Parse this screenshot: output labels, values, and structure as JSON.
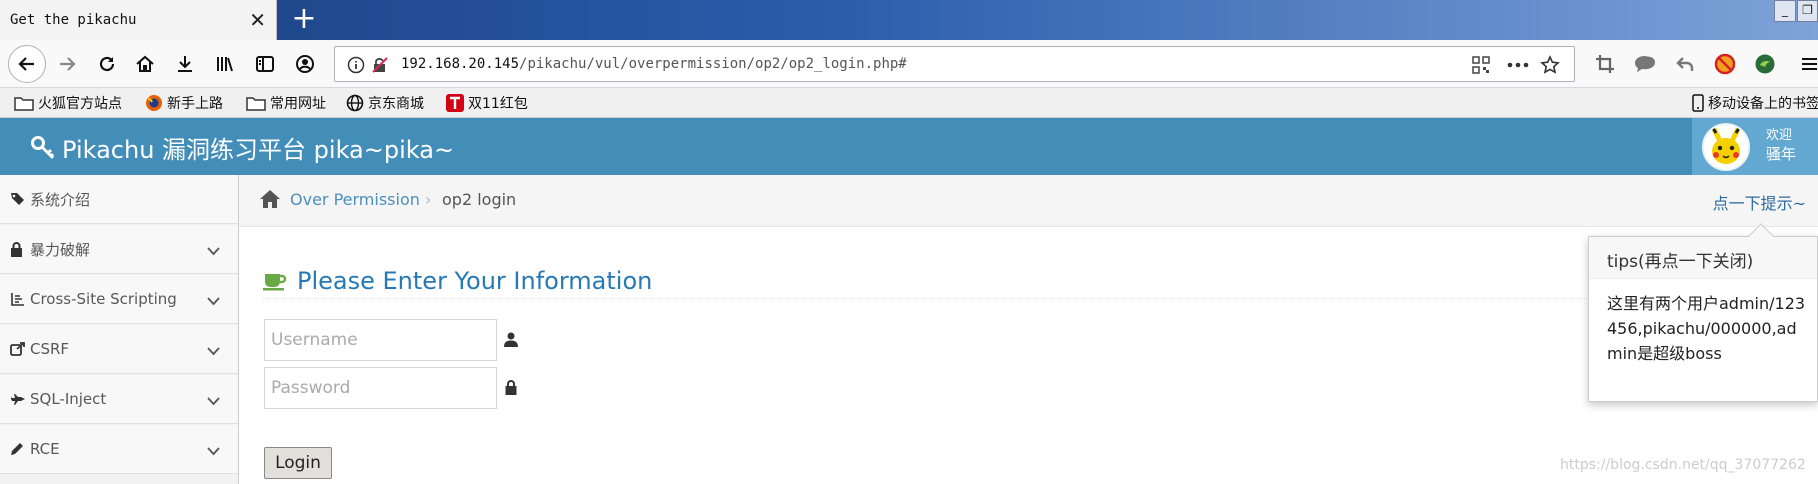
{
  "browser": {
    "tab_title": "Get the pikachu",
    "tab_close": "✕",
    "new_tab": "+",
    "url_host": "192.168.20.145",
    "url_path": "/pikachu/vul/overpermission/op2/op2_login.php#",
    "bookmarks": [
      "火狐官方站点",
      "新手上路",
      "常用网址",
      "京东商城",
      "双11红包"
    ],
    "mobile_bookmarks": "移动设备上的书签"
  },
  "app": {
    "title": "Pikachu 漏洞练习平台 pika~pika~",
    "welcome_line1": "欢迎",
    "welcome_line2": "骚年"
  },
  "sidebar": {
    "items": [
      {
        "label": "系统介绍",
        "icon": "tags-icon",
        "has_chevron": false
      },
      {
        "label": "暴力破解",
        "icon": "lock-icon",
        "has_chevron": true
      },
      {
        "label": "Cross-Site Scripting",
        "icon": "list-icon",
        "has_chevron": true
      },
      {
        "label": "CSRF",
        "icon": "share-icon",
        "has_chevron": true
      },
      {
        "label": "SQL-Inject",
        "icon": "fighter-jet-icon",
        "has_chevron": true
      },
      {
        "label": "RCE",
        "icon": "pencil-icon",
        "has_chevron": true
      }
    ]
  },
  "breadcrumb": {
    "link": "Over Permission",
    "separator": "›",
    "current": "op2 login",
    "hint": "点一下提示~"
  },
  "form": {
    "heading": "Please Enter Your Information",
    "username_placeholder": "Username",
    "password_placeholder": "Password",
    "login_label": "Login"
  },
  "tips": {
    "title": "tips(再点一下关闭)",
    "body": "这里有两个用户admin/123456,pikachu/000000,admin是超级boss"
  },
  "watermark": "https://blog.csdn.net/qq_37077262",
  "colors": {
    "header_bg": "#438eb9",
    "link": "#4c8fbd",
    "heading": "#2679b5"
  }
}
